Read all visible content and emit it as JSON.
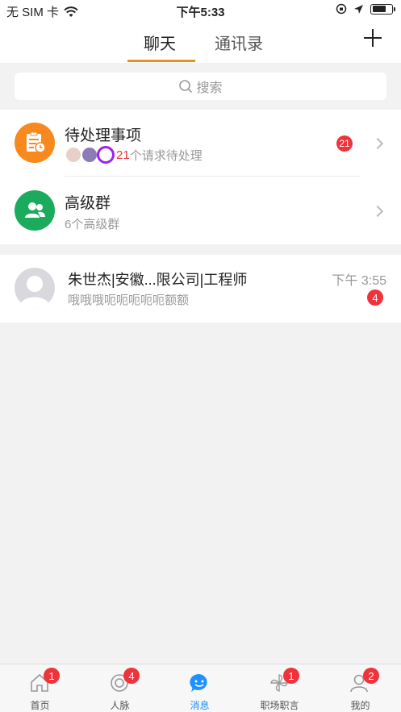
{
  "status_bar": {
    "carrier": "无 SIM 卡",
    "time": "下午5:33"
  },
  "header": {
    "tabs": [
      {
        "label": "聊天",
        "active": true
      },
      {
        "label": "通讯录",
        "active": false
      }
    ],
    "add_icon": "plus-icon"
  },
  "search": {
    "placeholder": "搜索"
  },
  "pending": {
    "title": "待处理事项",
    "count": "21",
    "subtitle": "个请求待处理",
    "badge": "21",
    "icon": "clipboard-clock-icon",
    "color": "#f7891f"
  },
  "groups": {
    "title": "高级群",
    "subtitle": "6个高级群",
    "icon": "group-icon",
    "color": "#1aab5d"
  },
  "chats": [
    {
      "name": "朱世杰|安徽...限公司|工程师",
      "preview": "哦哦哦呃呃呃呃呃额额",
      "time": "下午 3:55",
      "unread": "4"
    }
  ],
  "tabbar": {
    "items": [
      {
        "label": "首页",
        "icon": "home-icon",
        "badge": "1"
      },
      {
        "label": "人脉",
        "icon": "connections-icon",
        "badge": "4"
      },
      {
        "label": "消息",
        "icon": "message-icon",
        "badge": "",
        "active": true
      },
      {
        "label": "职场职言",
        "icon": "pinwheel-icon",
        "badge": "1"
      },
      {
        "label": "我的",
        "icon": "profile-icon",
        "badge": "2"
      }
    ]
  },
  "colors": {
    "accent": "#f08c1e",
    "badge": "#f0323c",
    "active_tab": "#1e90ff"
  }
}
